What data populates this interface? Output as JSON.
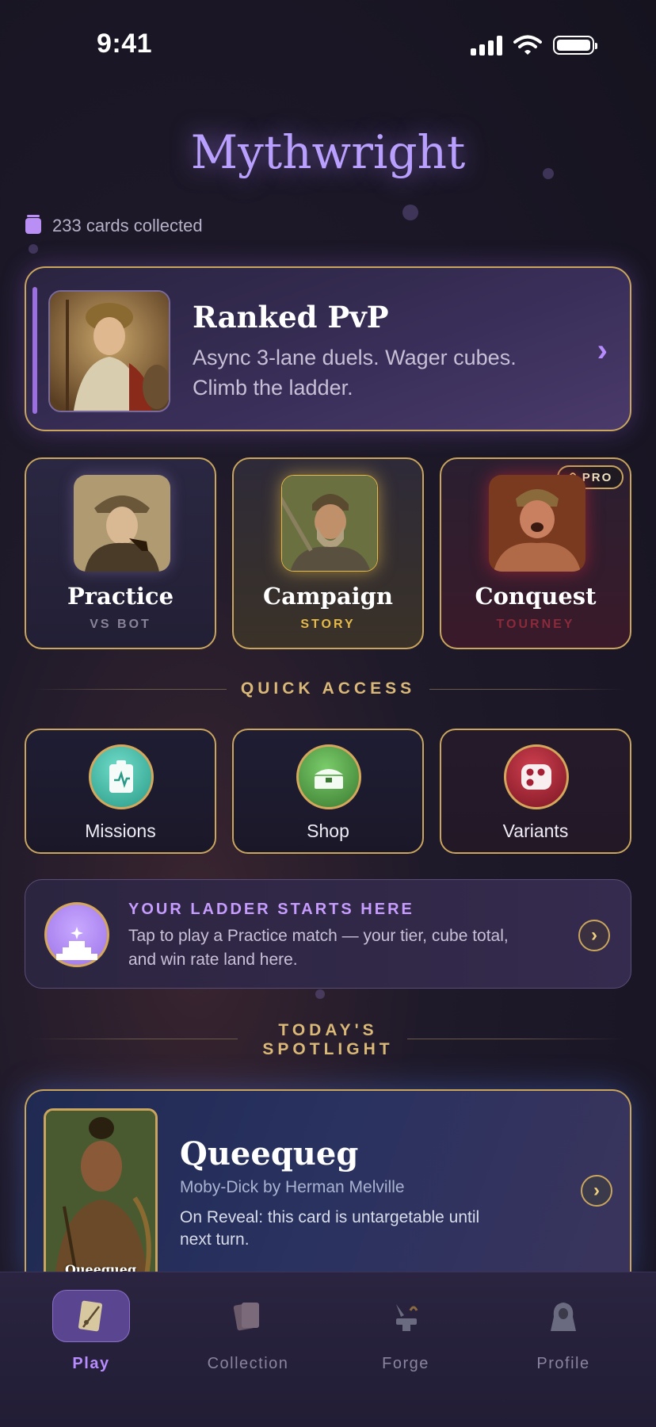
{
  "status_bar": {
    "time": "9:41"
  },
  "app": {
    "title": "Mythwright"
  },
  "collection": {
    "cards_collected": "233 cards collected"
  },
  "ranked": {
    "title": "Ranked PvP",
    "description": "Async 3-lane duels. Wager cubes. Climb the ladder."
  },
  "modes": [
    {
      "title": "Practice",
      "subtitle": "VS BOT",
      "subtitle_color": "#8a8398"
    },
    {
      "title": "Campaign",
      "subtitle": "STORY",
      "subtitle_color": "#e5b94a"
    },
    {
      "title": "Conquest",
      "subtitle": "TOURNEY",
      "subtitle_color": "#8a2a3a",
      "badge": "PRO"
    }
  ],
  "quick_access": {
    "heading": "QUICK ACCESS",
    "items": [
      {
        "label": "Missions",
        "icon": "clipboard-icon",
        "color": "#3fb5a5"
      },
      {
        "label": "Shop",
        "icon": "chest-icon",
        "color": "#4d9a45"
      },
      {
        "label": "Variants",
        "icon": "dice-icon",
        "color": "#a52035"
      }
    ]
  },
  "ladder": {
    "title": "YOUR LADDER STARTS HERE",
    "description": "Tap to play a Practice match — your tier, cube total, and win rate land here."
  },
  "spotlight": {
    "heading_line1": "TODAY'S",
    "heading_line2": "SPOTLIGHT",
    "card_name": "Queequeg",
    "title": "Queequeg",
    "source": "Moby-Dick by Herman Melville",
    "description": "On Reveal: this card is untargetable until next turn."
  },
  "tabs": [
    {
      "label": "Play",
      "icon": "play-card-icon",
      "active": true
    },
    {
      "label": "Collection",
      "icon": "card-stack-icon",
      "active": false
    },
    {
      "label": "Forge",
      "icon": "anvil-icon",
      "active": false
    },
    {
      "label": "Profile",
      "icon": "hooded-figure-icon",
      "active": false
    }
  ]
}
